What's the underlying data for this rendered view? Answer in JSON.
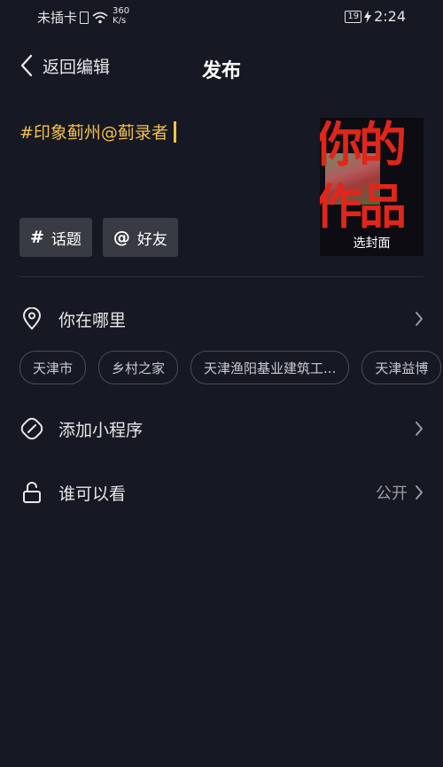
{
  "status_bar": {
    "carrier": "未插卡",
    "net_speed_value": "360",
    "net_speed_unit": "K/s",
    "battery": "19",
    "time": "2:24"
  },
  "nav": {
    "back_label": "返回编辑",
    "title": "发布"
  },
  "caption": {
    "text": "#印象蓟州@蓟录者"
  },
  "cover": {
    "overlay_line1": "你的",
    "overlay_line2": "作品",
    "label": "选封面"
  },
  "chips": [
    {
      "symbol": "#",
      "label": "话题"
    },
    {
      "symbol": "@",
      "label": "好友"
    }
  ],
  "location": {
    "label": "你在哪里",
    "suggestions": [
      "天津市",
      "乡村之家",
      "天津渔阳基业建筑工...",
      "天津益博"
    ]
  },
  "mini_program": {
    "label": "添加小程序"
  },
  "visibility": {
    "label": "谁可以看",
    "value": "公开"
  },
  "colors": {
    "background": "#161823",
    "accent_caption": "#f2c14e",
    "overlay_red": "#e0261b"
  },
  "icons": [
    "back-chevron-icon",
    "location-pin-icon",
    "link-icon",
    "lock-icon",
    "chevron-right-icon",
    "wifi-icon",
    "sim-icon",
    "charging-icon"
  ]
}
